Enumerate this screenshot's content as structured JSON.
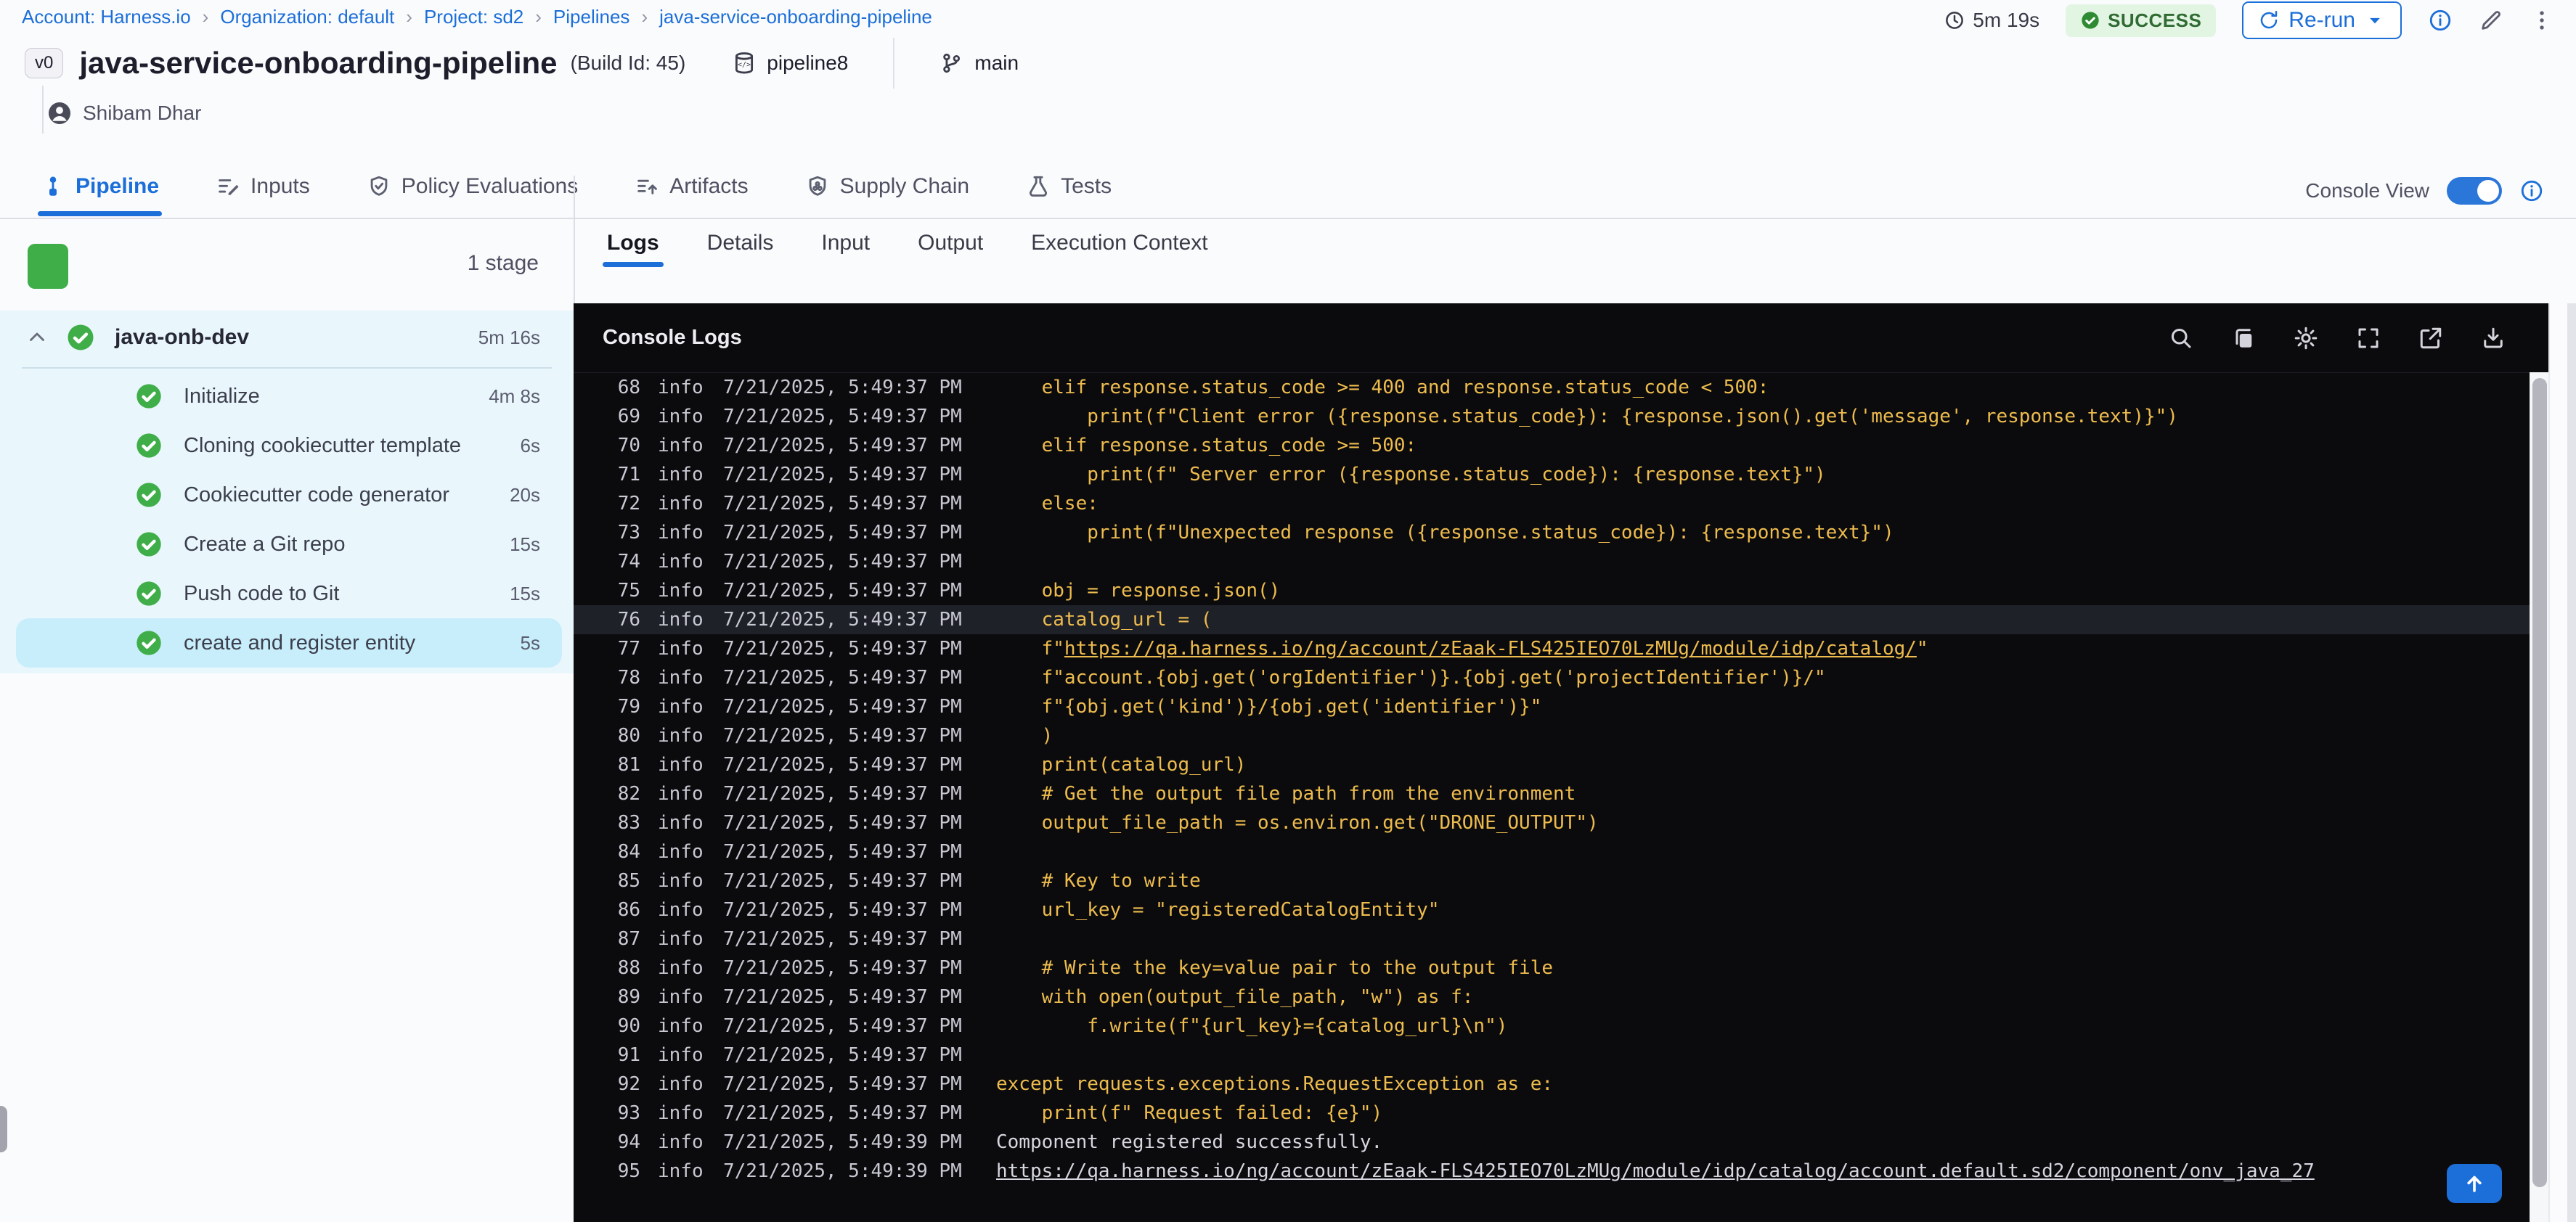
{
  "breadcrumb": {
    "separator": "›",
    "items": [
      "Account: Harness.io",
      "Organization: default",
      "Project: sd2",
      "Pipelines",
      "java-service-onboarding-pipeline"
    ]
  },
  "run_meta": {
    "elapsed": "5m 19s",
    "status": "SUCCESS",
    "rerun_label": "Re-run"
  },
  "header": {
    "version_badge": "v0",
    "title": "java-service-onboarding-pipeline",
    "build_id": "(Build Id: 45)",
    "repo": "pipeline8",
    "branch": "main",
    "user": "Shibam Dhar"
  },
  "tabs": [
    {
      "label": "Pipeline",
      "active": true
    },
    {
      "label": "Inputs"
    },
    {
      "label": "Policy Evaluations"
    },
    {
      "label": "Artifacts"
    },
    {
      "label": "Supply Chain"
    },
    {
      "label": "Tests"
    }
  ],
  "console_view": {
    "label": "Console View",
    "enabled": true
  },
  "sidebar": {
    "stage_count": "1 stage",
    "stage": {
      "name": "java-onb-dev",
      "duration": "5m 16s"
    },
    "steps": [
      {
        "name": "Initialize",
        "duration": "4m 8s"
      },
      {
        "name": "Cloning cookiecutter template",
        "duration": "6s"
      },
      {
        "name": "Cookiecutter code generator",
        "duration": "20s"
      },
      {
        "name": "Create a Git repo",
        "duration": "15s"
      },
      {
        "name": "Push code to Git",
        "duration": "15s"
      },
      {
        "name": "create and register entity",
        "duration": "5s",
        "selected": true
      }
    ]
  },
  "log_tabs": [
    "Logs",
    "Details",
    "Input",
    "Output",
    "Execution Context"
  ],
  "console": {
    "title": "Console Logs",
    "icons": [
      "search",
      "copy",
      "settings",
      "fullscreen",
      "open-in-new",
      "download"
    ]
  },
  "colors": {
    "accent": "#1c6fd8",
    "success_green": "#3fae49",
    "log_gold": "#eebc4e",
    "console_bg": "#0b0b0d",
    "sidebar_blue": "#e9f7fd",
    "selected_step": "#c9eefb"
  },
  "logs": {
    "lines": [
      {
        "n": 68,
        "level": "info",
        "time": "7/21/2025, 5:49:37 PM",
        "ind": 4,
        "text": "elif response.status_code >= 400 and response.status_code < 500:"
      },
      {
        "n": 69,
        "level": "info",
        "time": "7/21/2025, 5:49:37 PM",
        "ind": 8,
        "text": "print(f\"Client error ({response.status_code}): {response.json().get('message', response.text)}\")"
      },
      {
        "n": 70,
        "level": "info",
        "time": "7/21/2025, 5:49:37 PM",
        "ind": 4,
        "text": "elif response.status_code >= 500:"
      },
      {
        "n": 71,
        "level": "info",
        "time": "7/21/2025, 5:49:37 PM",
        "ind": 8,
        "text": "print(f\" Server error ({response.status_code}): {response.text}\")"
      },
      {
        "n": 72,
        "level": "info",
        "time": "7/21/2025, 5:49:37 PM",
        "ind": 4,
        "text": "else:"
      },
      {
        "n": 73,
        "level": "info",
        "time": "7/21/2025, 5:49:37 PM",
        "ind": 8,
        "text": "print(f\"Unexpected response ({response.status_code}): {response.text}\")"
      },
      {
        "n": 74,
        "level": "info",
        "time": "7/21/2025, 5:49:37 PM",
        "ind": 0,
        "text": ""
      },
      {
        "n": 75,
        "level": "info",
        "time": "7/21/2025, 5:49:37 PM",
        "ind": 4,
        "text": "obj = response.json()"
      },
      {
        "n": 76,
        "level": "info",
        "time": "7/21/2025, 5:49:37 PM",
        "ind": 4,
        "text": "catalog_url = (",
        "hl": true
      },
      {
        "n": 77,
        "level": "info",
        "time": "7/21/2025, 5:49:37 PM",
        "ind": 4,
        "pre": "f\"",
        "link": "https://qa.harness.io/ng/account/zEaak-FLS425IEO70LzMUg/module/idp/catalog/",
        "post": "\""
      },
      {
        "n": 78,
        "level": "info",
        "time": "7/21/2025, 5:49:37 PM",
        "ind": 4,
        "text": "f\"account.{obj.get('orgIdentifier')}.{obj.get('projectIdentifier')}/\""
      },
      {
        "n": 79,
        "level": "info",
        "time": "7/21/2025, 5:49:37 PM",
        "ind": 4,
        "text": "f\"{obj.get('kind')}/{obj.get('identifier')}\""
      },
      {
        "n": 80,
        "level": "info",
        "time": "7/21/2025, 5:49:37 PM",
        "ind": 4,
        "text": ")"
      },
      {
        "n": 81,
        "level": "info",
        "time": "7/21/2025, 5:49:37 PM",
        "ind": 4,
        "text": "print(catalog_url)"
      },
      {
        "n": 82,
        "level": "info",
        "time": "7/21/2025, 5:49:37 PM",
        "ind": 4,
        "text": "# Get the output file path from the environment"
      },
      {
        "n": 83,
        "level": "info",
        "time": "7/21/2025, 5:49:37 PM",
        "ind": 4,
        "text": "output_file_path = os.environ.get(\"DRONE_OUTPUT\")"
      },
      {
        "n": 84,
        "level": "info",
        "time": "7/21/2025, 5:49:37 PM",
        "ind": 0,
        "text": ""
      },
      {
        "n": 85,
        "level": "info",
        "time": "7/21/2025, 5:49:37 PM",
        "ind": 4,
        "text": "# Key to write"
      },
      {
        "n": 86,
        "level": "info",
        "time": "7/21/2025, 5:49:37 PM",
        "ind": 4,
        "text": "url_key = \"registeredCatalogEntity\""
      },
      {
        "n": 87,
        "level": "info",
        "time": "7/21/2025, 5:49:37 PM",
        "ind": 0,
        "text": ""
      },
      {
        "n": 88,
        "level": "info",
        "time": "7/21/2025, 5:49:37 PM",
        "ind": 4,
        "text": "# Write the key=value pair to the output file"
      },
      {
        "n": 89,
        "level": "info",
        "time": "7/21/2025, 5:49:37 PM",
        "ind": 4,
        "text": "with open(output_file_path, \"w\") as f:"
      },
      {
        "n": 90,
        "level": "info",
        "time": "7/21/2025, 5:49:37 PM",
        "ind": 8,
        "text": "f.write(f\"{url_key}={catalog_url}\\n\")"
      },
      {
        "n": 91,
        "level": "info",
        "time": "7/21/2025, 5:49:37 PM",
        "ind": 0,
        "text": ""
      },
      {
        "n": 92,
        "level": "info",
        "time": "7/21/2025, 5:49:37 PM",
        "ind": 0,
        "text": "except requests.exceptions.RequestException as e:"
      },
      {
        "n": 93,
        "level": "info",
        "time": "7/21/2025, 5:49:37 PM",
        "ind": 4,
        "text": "print(f\" Request failed: {e}\")"
      },
      {
        "n": 94,
        "level": "info",
        "time": "7/21/2025, 5:49:39 PM",
        "ind": 0,
        "plain": true,
        "text": "Component registered successfully."
      },
      {
        "n": 95,
        "level": "info",
        "time": "7/21/2025, 5:49:39 PM",
        "ind": 0,
        "plain": true,
        "link": "https://qa.harness.io/ng/account/zEaak-FLS425IEO70LzMUg/module/idp/catalog/account.default.sd2/component/onv_java_27"
      }
    ]
  }
}
